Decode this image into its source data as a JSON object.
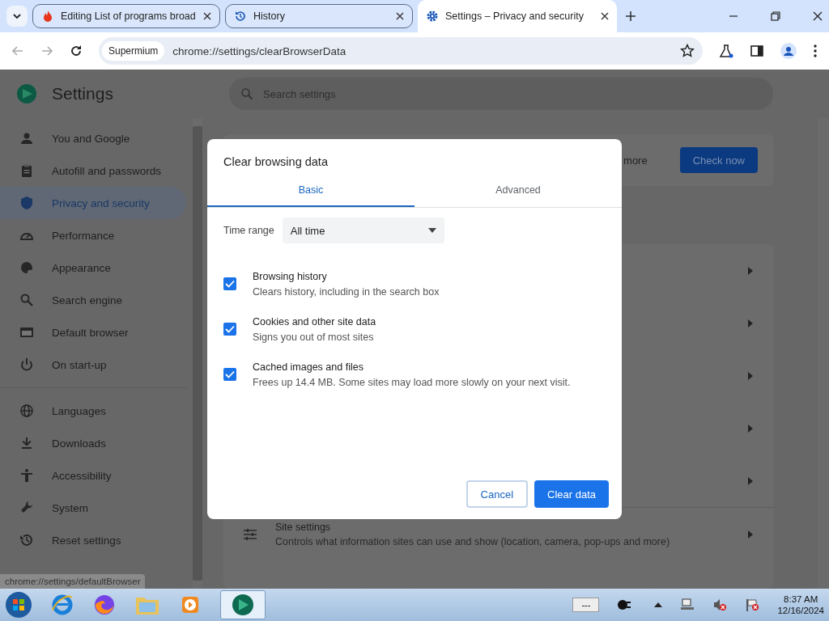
{
  "browser": {
    "tabs": [
      {
        "title": "Editing List of programs broad",
        "selected": false
      },
      {
        "title": "History",
        "selected": false
      },
      {
        "title": "Settings – Privacy and security",
        "selected": true
      }
    ],
    "site_chip": "Supermium",
    "url": "chrome://settings/clearBrowserData"
  },
  "settings": {
    "title": "Settings",
    "search": {
      "placeholder": "Search settings"
    },
    "nav_groups": [
      [
        {
          "label": "You and Google",
          "selected": false
        },
        {
          "label": "Autofill and passwords",
          "selected": false
        },
        {
          "label": "Privacy and security",
          "selected": true
        },
        {
          "label": "Performance",
          "selected": false
        },
        {
          "label": "Appearance",
          "selected": false
        },
        {
          "label": "Search engine",
          "selected": false
        },
        {
          "label": "Default browser",
          "selected": false
        },
        {
          "label": "On start-up",
          "selected": false
        }
      ],
      [
        {
          "label": "Languages",
          "selected": false
        },
        {
          "label": "Downloads",
          "selected": false
        },
        {
          "label": "Accessibility",
          "selected": false
        },
        {
          "label": "System",
          "selected": false
        },
        {
          "label": "Reset settings",
          "selected": false
        }
      ]
    ],
    "check_card": {
      "text": "more",
      "button": "Check now"
    },
    "site_settings": {
      "title": "Site settings",
      "description": "Controls what information sites can use and show (location, camera, pop-ups and more)"
    }
  },
  "dialog": {
    "title": "Clear browsing data",
    "tabs": [
      {
        "label": "Basic",
        "selected": true
      },
      {
        "label": "Advanced",
        "selected": false
      }
    ],
    "time_range": {
      "label": "Time range",
      "value": "All time"
    },
    "options": [
      {
        "title": "Browsing history",
        "description": "Clears history, including in the search box",
        "checked": true
      },
      {
        "title": "Cookies and other site data",
        "description": "Signs you out of most sites",
        "checked": true
      },
      {
        "title": "Cached images and files",
        "description": "Frees up 14.4 MB. Some sites may load more slowly on your next visit.",
        "checked": true
      }
    ],
    "cancel": "Cancel",
    "confirm": "Clear data"
  },
  "status_url": "chrome://settings/defaultBrowser",
  "taskbar": {
    "battery": "---",
    "time": "8:37 AM",
    "date": "12/16/2024"
  }
}
